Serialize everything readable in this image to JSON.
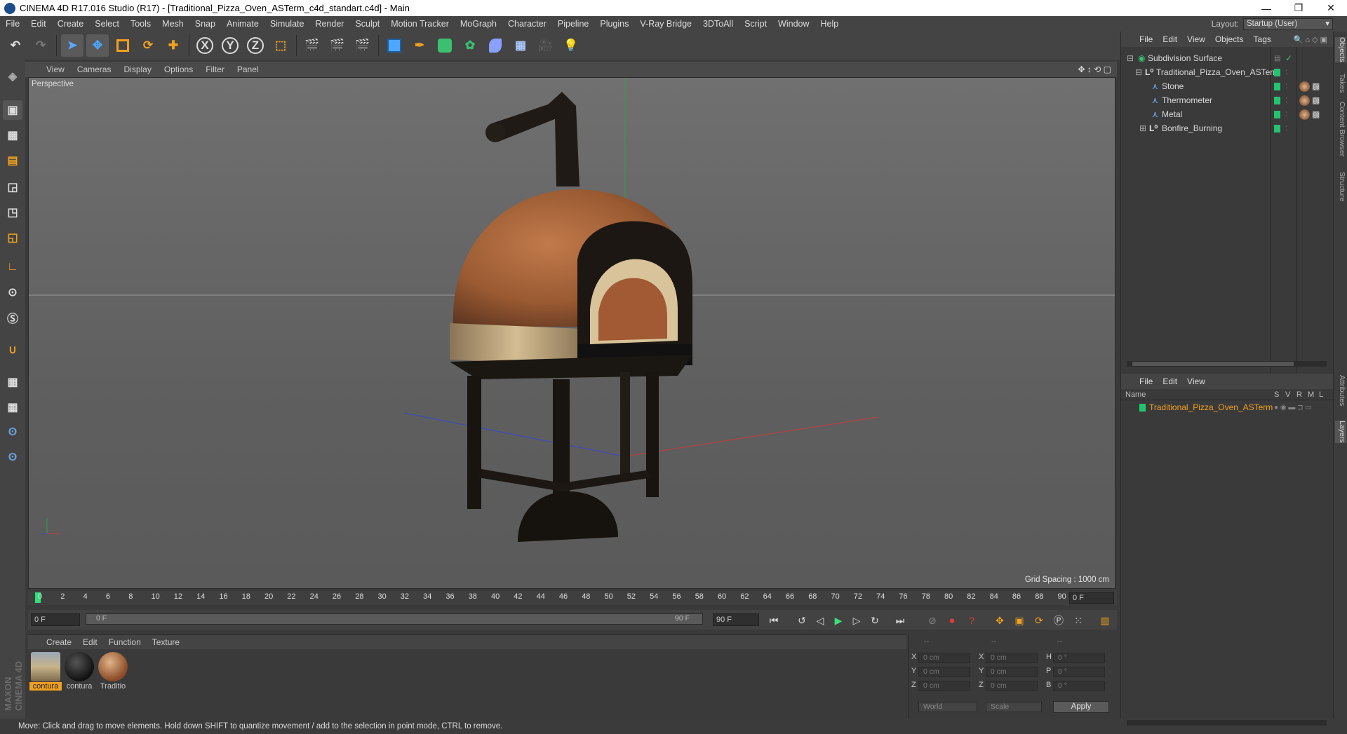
{
  "window": {
    "title": "CINEMA 4D R17.016 Studio (R17) - [Traditional_Pizza_Oven_ASTerm_c4d_standart.c4d] - Main"
  },
  "menu": [
    "File",
    "Edit",
    "Create",
    "Select",
    "Tools",
    "Mesh",
    "Snap",
    "Animate",
    "Simulate",
    "Render",
    "Sculpt",
    "Motion Tracker",
    "MoGraph",
    "Character",
    "Pipeline",
    "Plugins",
    "V-Ray Bridge",
    "3DToAll",
    "Script",
    "Window",
    "Help"
  ],
  "layout": {
    "label": "Layout:",
    "value": "Startup (User)"
  },
  "toolbar_axes": [
    "X",
    "Y",
    "Z"
  ],
  "viewport": {
    "menu": [
      "View",
      "Cameras",
      "Display",
      "Options",
      "Filter",
      "Panel"
    ],
    "label": "Perspective",
    "grid_spacing": "Grid Spacing : 1000 cm"
  },
  "timeline": {
    "ticks": [
      "0",
      "2",
      "4",
      "6",
      "8",
      "10",
      "12",
      "14",
      "16",
      "18",
      "20",
      "22",
      "24",
      "26",
      "28",
      "30",
      "32",
      "34",
      "36",
      "38",
      "40",
      "42",
      "44",
      "46",
      "48",
      "50",
      "52",
      "54",
      "56",
      "58",
      "60",
      "62",
      "64",
      "66",
      "68",
      "70",
      "72",
      "74",
      "76",
      "78",
      "80",
      "82",
      "84",
      "86",
      "88",
      "90"
    ],
    "end_field": "0 F",
    "current_frame": "0 F",
    "range_start": "0 F",
    "range_end": "90 F",
    "max_frame": "90 F"
  },
  "materials": {
    "menu": [
      "Create",
      "Edit",
      "Function",
      "Texture"
    ],
    "items": [
      {
        "name": "contura",
        "selected": true
      },
      {
        "name": "contura",
        "selected": false
      },
      {
        "name": "Traditio",
        "selected": false
      }
    ]
  },
  "coords": {
    "header": [
      "--",
      "--",
      "--"
    ],
    "rows": [
      {
        "a": "X",
        "av": "0 cm",
        "b": "X",
        "bv": "0 cm",
        "c": "H",
        "cv": "0 °"
      },
      {
        "a": "Y",
        "av": "0 cm",
        "b": "Y",
        "bv": "0 cm",
        "c": "P",
        "cv": "0 °"
      },
      {
        "a": "Z",
        "av": "0 cm",
        "b": "Z",
        "bv": "0 cm",
        "c": "B",
        "cv": "0 °"
      }
    ],
    "world": "World",
    "scale": "Scale",
    "apply": "Apply"
  },
  "status": "Move: Click and drag to move elements. Hold down SHIFT to quantize movement / add to the selection in point mode, CTRL to remove.",
  "objects": {
    "menu": [
      "File",
      "Edit",
      "View",
      "Objects",
      "Tags"
    ],
    "tree": [
      {
        "name": "Subdivision Surface"
      },
      {
        "name": "Traditional_Pizza_Oven_ASTerm"
      },
      {
        "name": "Stone"
      },
      {
        "name": "Thermometer"
      },
      {
        "name": "Metal"
      },
      {
        "name": "Bonfire_Burning"
      }
    ]
  },
  "layers": {
    "menu": [
      "File",
      "Edit",
      "View"
    ],
    "col_name": "Name",
    "cols": [
      "S",
      "V",
      "R",
      "M",
      "L"
    ],
    "items": [
      "Traditional_Pizza_Oven_ASTerm"
    ]
  },
  "side_tabs": [
    "Objects",
    "Takes",
    "Content Browser",
    "Structure",
    "Attributes",
    "Layers"
  ],
  "brand": "MAXON CINEMA 4D"
}
